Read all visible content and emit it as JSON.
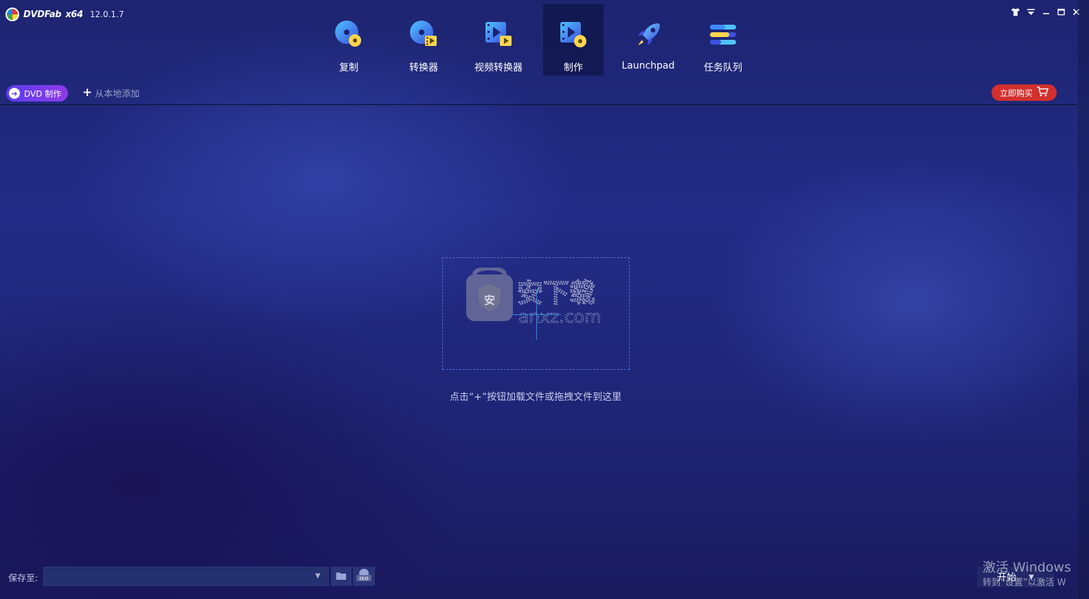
{
  "app": {
    "brand": "DVDFab",
    "arch": "x64",
    "version": "12.0.1.7"
  },
  "window_controls": [
    "skin-icon",
    "menu-icon",
    "minimize-icon",
    "maximize-icon",
    "close-icon"
  ],
  "nav": {
    "items": [
      {
        "id": "copy",
        "label": "复制",
        "icon": "disc-copy-icon"
      },
      {
        "id": "ripper",
        "label": "转换器",
        "icon": "disc-ripper-icon"
      },
      {
        "id": "video-converter",
        "label": "视频转换器",
        "icon": "video-converter-icon"
      },
      {
        "id": "creator",
        "label": "制作",
        "icon": "creator-icon",
        "active": true
      },
      {
        "id": "launchpad",
        "label": "Launchpad",
        "icon": "rocket-icon"
      },
      {
        "id": "task-queue",
        "label": "任务队列",
        "icon": "task-queue-icon"
      }
    ]
  },
  "toolbar": {
    "mode_label": "DVD 制作",
    "add_local_label": "从本地添加",
    "buy_label": "立即购买"
  },
  "dropzone": {
    "watermark_text": "安下载",
    "watermark_sub": "anxz.com",
    "watermark_badge": "安",
    "hint": "点击“+”按钮加载文件或拖拽文件到这里"
  },
  "bottom": {
    "save_label": "保存至:",
    "save_value": "",
    "start_label": "开始"
  },
  "activation": {
    "line1": "激活 Windows",
    "line2": "转到“设置”以激活 W"
  },
  "colors": {
    "accent_purple": "#6a3de8",
    "buy_red": "#d32f2f",
    "dropzone_border": "#4f6fd6"
  }
}
